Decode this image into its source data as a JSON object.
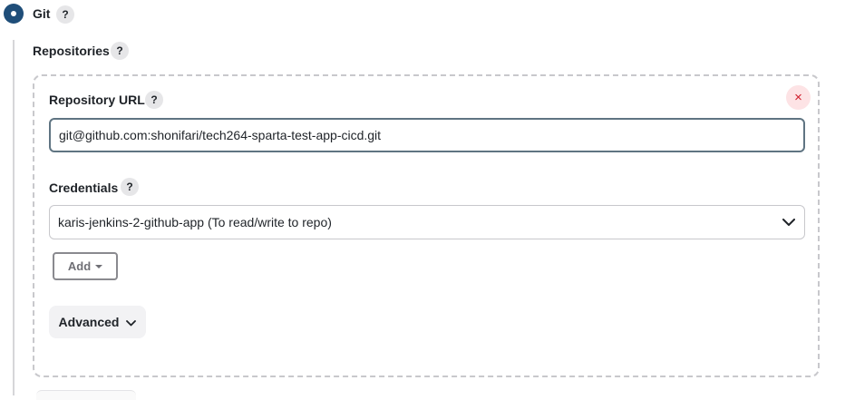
{
  "scm": {
    "option_label": "Git",
    "selected": true
  },
  "repositories": {
    "section_label": "Repositories",
    "repository_url_label": "Repository URL",
    "repository_url_value": "git@github.com:shonifari/tech264-sparta-test-app-cicd.git",
    "credentials_label": "Credentials",
    "credentials_value": "karis-jenkins-2-github-app (To read/write to repo)",
    "add_button_label": "Add",
    "advanced_button_label": "Advanced",
    "close_symbol": "×"
  },
  "help_symbol": "?",
  "colors": {
    "radio_selected": "#1f4e79",
    "input_border_focus": "#5f7482",
    "close_bg": "#fde3e5",
    "close_fg": "#d01d2b"
  },
  "icons": [
    "radio-selected-icon",
    "help-icon",
    "close-icon",
    "chevron-down-icon",
    "caret-down-icon"
  ]
}
